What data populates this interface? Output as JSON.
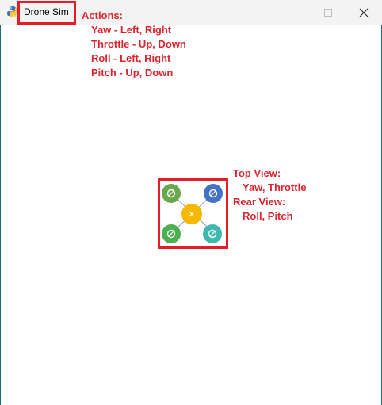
{
  "window": {
    "title": "Drone Sim",
    "controls": {
      "minimize": "minimize",
      "maximize": "maximize",
      "close": "close"
    }
  },
  "actions": {
    "heading": "Actions:",
    "items": [
      "Yaw - Left, Right",
      "Throttle - Up, Down",
      "Roll - Left, Right",
      "Pitch - Up, Down"
    ]
  },
  "views": {
    "top_heading": "Top View:",
    "top_detail": "Yaw, Throttle",
    "rear_heading": "Rear View:",
    "rear_detail": "Roll, Pitch"
  },
  "colors": {
    "annotation": "#e41d28",
    "annotation_text": "#d9262e",
    "rotor_front_left": "#6aa84f",
    "rotor_front_right": "#4472c4",
    "rotor_rear_left": "#4caf50",
    "rotor_rear_right": "#3fb8b0",
    "body": "#f5b800"
  }
}
